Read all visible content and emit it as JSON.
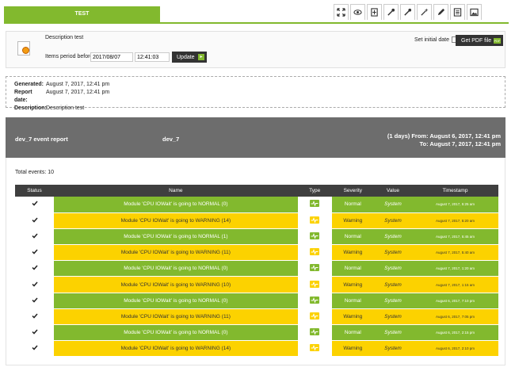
{
  "tab": {
    "title": "TEST"
  },
  "toolbar": {
    "buttons": [
      {
        "icon": "fullscreen-icon"
      },
      {
        "icon": "eye-icon"
      },
      {
        "icon": "add-item-icon"
      },
      {
        "icon": "wand-icon"
      },
      {
        "icon": "wand-icon"
      },
      {
        "icon": "magic-wand-icon"
      },
      {
        "icon": "pencil-icon"
      },
      {
        "icon": "list-icon"
      },
      {
        "icon": "image-icon"
      }
    ]
  },
  "filter": {
    "description": "Description test",
    "period_label": "Items period before:",
    "date_value": "2017/08/07",
    "time_value": "12:41:03",
    "update_label": "Update",
    "initial_date_label": "Set initial date",
    "pdf_label": "Get PDF file",
    "pdf_badge": "PDF"
  },
  "info": {
    "generated_label": "Generated:",
    "generated": "August 7, 2017, 12:41 pm",
    "report_date_label": "Report date:",
    "report_date": "August 7, 2017, 12:41 pm",
    "description_label": "Description:",
    "description": "Description test"
  },
  "report": {
    "title": "dev_7 event report",
    "agent": "dev_7",
    "range_line1": "(1 days) From: August 6, 2017, 12:41 pm",
    "range_line2": "To: August 7, 2017, 12:41 pm",
    "total_events": "Total events: 10"
  },
  "table": {
    "headers": [
      "Status",
      "Name",
      "Type",
      "Severity",
      "Value",
      "Timestamp"
    ],
    "rows": [
      {
        "name": "Module 'CPU IOWait' is going to NORMAL (0)",
        "severity": "Normal",
        "value": "System",
        "timestamp": "August 7, 2017, 5:25 am"
      },
      {
        "name": "Module 'CPU IOWait' is going to WARNING (14)",
        "severity": "Warning",
        "value": "System",
        "timestamp": "August 7, 2017, 5:20 am"
      },
      {
        "name": "Module 'CPU IOWait' is going to NORMAL (1)",
        "severity": "Normal",
        "value": "System",
        "timestamp": "August 7, 2017, 5:45 am"
      },
      {
        "name": "Module 'CPU IOWait' is going to WARNING (11)",
        "severity": "Warning",
        "value": "System",
        "timestamp": "August 7, 2017, 5:40 am"
      },
      {
        "name": "Module 'CPU IOWait' is going to NORMAL (0)",
        "severity": "Normal",
        "value": "System",
        "timestamp": "August 7, 2017, 1:20 am"
      },
      {
        "name": "Module 'CPU IOWait' is going to WARNING (10)",
        "severity": "Warning",
        "value": "System",
        "timestamp": "August 7, 2017, 1:15 am"
      },
      {
        "name": "Module 'CPU IOWait' is going to NORMAL (0)",
        "severity": "Normal",
        "value": "System",
        "timestamp": "August 6, 2017, 7:10 pm"
      },
      {
        "name": "Module 'CPU IOWait' is going to WARNING (11)",
        "severity": "Warning",
        "value": "System",
        "timestamp": "August 6, 2017, 7:05 pm"
      },
      {
        "name": "Module 'CPU IOWait' is going to NORMAL (0)",
        "severity": "Normal",
        "value": "System",
        "timestamp": "August 6, 2017, 2:15 pm"
      },
      {
        "name": "Module 'CPU IOWait' is going to WARNING (14)",
        "severity": "Warning",
        "value": "System",
        "timestamp": "August 6, 2017, 2:10 pm"
      }
    ]
  },
  "colors": {
    "accent_green": "#82b92e",
    "warning_yellow": "#fcd200",
    "header_gray": "#6d6d6d",
    "table_header": "#3f3f3f"
  }
}
